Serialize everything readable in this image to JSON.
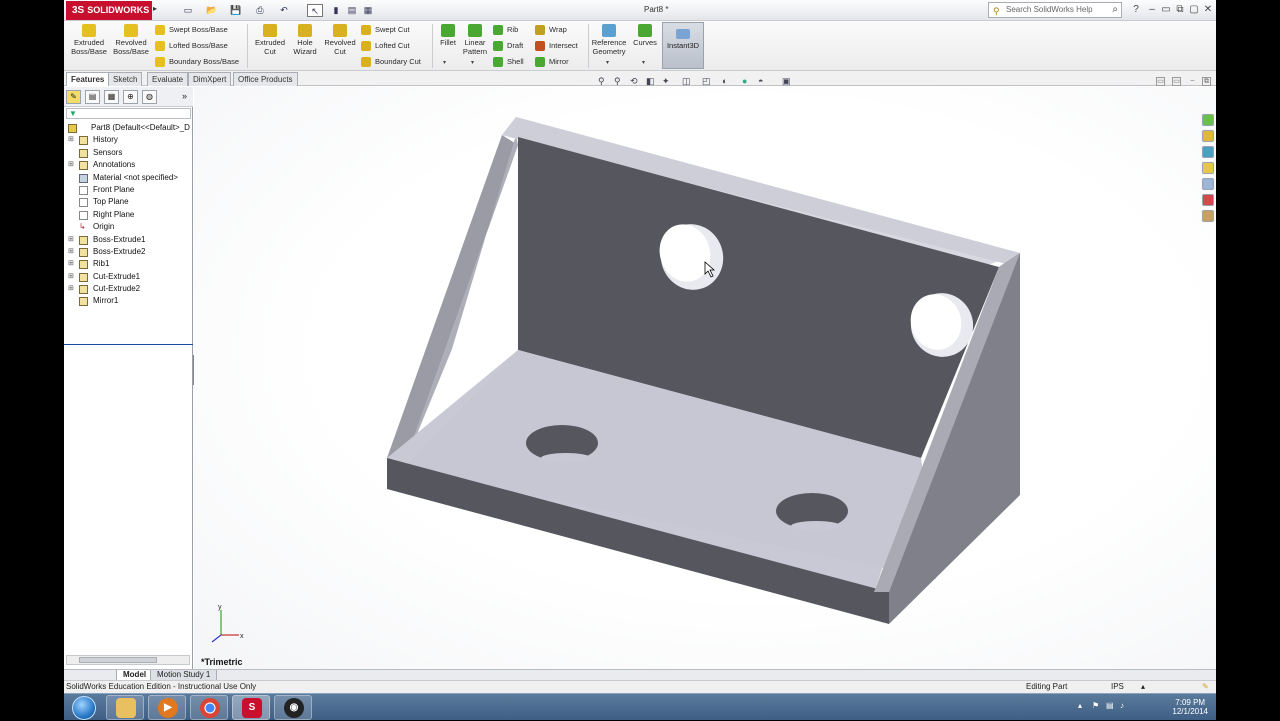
{
  "app": {
    "brand": "SOLIDWORKS",
    "document_title": "Part8 *"
  },
  "search": {
    "placeholder": "Search SolidWorks Help"
  },
  "command_manager": {
    "big_buttons": [
      {
        "label1": "Extruded",
        "label2": "Boss/Base"
      },
      {
        "label1": "Revolved",
        "label2": "Boss/Base"
      },
      {
        "label1": "Extruded",
        "label2": "Cut"
      },
      {
        "label1": "Hole",
        "label2": "Wizard"
      },
      {
        "label1": "Revolved",
        "label2": "Cut"
      },
      {
        "label1": "Fillet",
        "label2": ""
      },
      {
        "label1": "Linear",
        "label2": "Pattern"
      },
      {
        "label1": "Reference",
        "label2": "Geometry"
      },
      {
        "label1": "Curves",
        "label2": ""
      }
    ],
    "small_buttons": {
      "swept_boss": "Swept Boss/Base",
      "lofted_boss": "Lofted Boss/Base",
      "boundary_boss": "Boundary Boss/Base",
      "swept_cut": "Swept Cut",
      "lofted_cut": "Lofted Cut",
      "boundary_cut": "Boundary Cut",
      "rib": "Rib",
      "draft": "Draft",
      "shell": "Shell",
      "wrap": "Wrap",
      "intersect": "Intersect",
      "mirror": "Mirror"
    },
    "instant3d": "Instant3D"
  },
  "tabs": [
    "Features",
    "Sketch",
    "Evaluate",
    "DimXpert",
    "Office Products"
  ],
  "feature_tree": {
    "root": "Part8  (Default<<Default>_D",
    "items": [
      "History",
      "Sensors",
      "Annotations",
      "Material <not specified>",
      "Front Plane",
      "Top Plane",
      "Right Plane",
      "Origin",
      "Boss-Extrude1",
      "Boss-Extrude2",
      "Rib1",
      "Cut-Extrude1",
      "Cut-Extrude2",
      "Mirror1"
    ]
  },
  "viewport": {
    "view_orientation": "*Trimetric",
    "triad": {
      "x": "x",
      "y": "y"
    }
  },
  "bottom_tabs": [
    "Model",
    "Motion Study 1"
  ],
  "status": {
    "left": "SolidWorks Education Edition - Instructional Use Only",
    "mode": "Editing Part",
    "units": "IPS"
  },
  "taskbar": {
    "time": "7:09 PM",
    "date": "12/1/2014",
    "app_letter": "S"
  },
  "colors": {
    "brand": "#c8102e",
    "part_top": "#c9cad6",
    "part_side": "#6e6f78",
    "part_dark": "#55565e"
  }
}
